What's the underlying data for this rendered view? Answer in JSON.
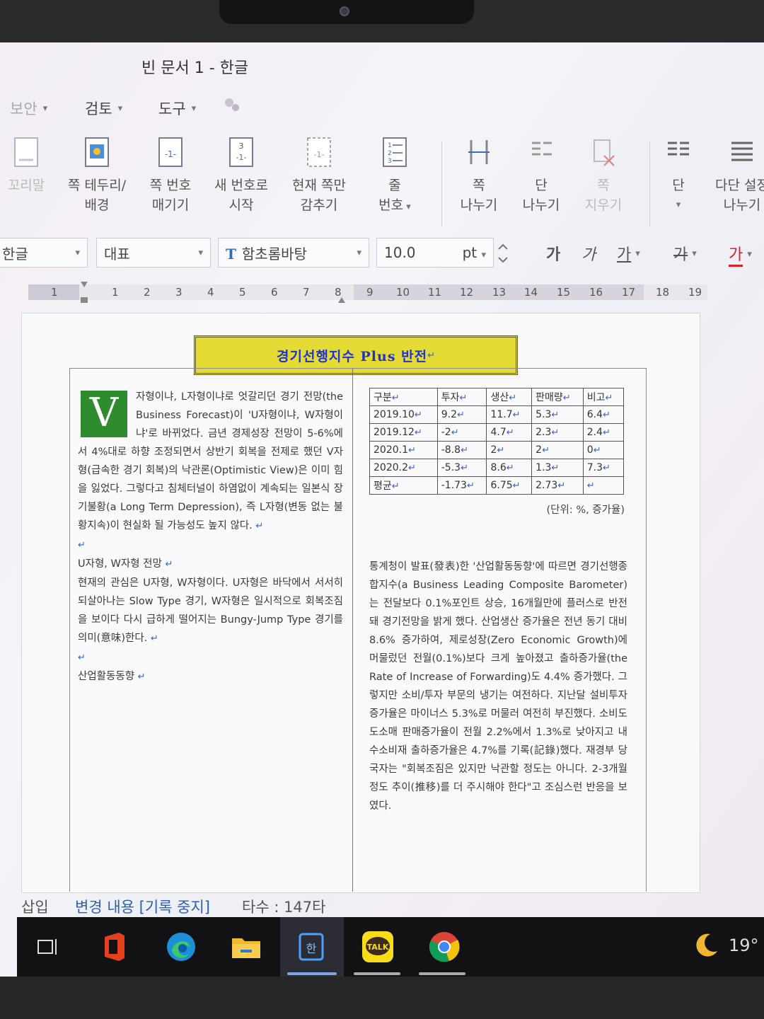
{
  "window": {
    "title": "빈 문서 1 - 한글"
  },
  "menu": [
    {
      "label": "보안"
    },
    {
      "label": "검토"
    },
    {
      "label": "도구"
    }
  ],
  "ribbon": [
    {
      "label1": "꼬리말",
      "label2": ""
    },
    {
      "label1": "쪽 테두리/",
      "label2": "배경"
    },
    {
      "label1": "쪽 번호",
      "label2": "매기기"
    },
    {
      "label1": "새 번호로",
      "label2": "시작"
    },
    {
      "label1": "현재 쪽만",
      "label2": "감추기"
    },
    {
      "label1": "줄",
      "label2": "번호"
    },
    {
      "label1": "쪽",
      "label2": "나누기"
    },
    {
      "label1": "단",
      "label2": "나누기"
    },
    {
      "label1": "쪽",
      "label2": "지우기"
    },
    {
      "label1": "단",
      "label2": ""
    },
    {
      "label1": "다단 설정",
      "label2": "나누기"
    }
  ],
  "format": {
    "language": "한글",
    "style": "대표",
    "font": "함초롬바탕",
    "font_glyph": "T",
    "size": "10.0",
    "unit": "pt",
    "bold": "가",
    "italic": "가",
    "underline": "가",
    "strike": "가",
    "color": "가",
    "color_accent": "#e02020"
  },
  "ruler": {
    "ticks": [
      "1",
      "1",
      "2",
      "3",
      "4",
      "5",
      "6",
      "7",
      "8",
      "9",
      "10",
      "11",
      "12",
      "13",
      "14",
      "15",
      "16",
      "17",
      "18",
      "19"
    ]
  },
  "document": {
    "title": "경기선행지수 Plus 반전",
    "dropcap": "V",
    "left_paragraphs": [
      "자형이냐, L자형이냐로 엇갈리던 경기 전망(the Business Forecast)이 'U자형이냐, W자형이냐'로 바뀌었다. 금년 경제성장 전망이 5-6%에서 4%대로 하향 조정되면서 상반기 회복을 전제로 했던 V자형(급속한 경기 회복)의 낙관론(Optimistic View)은 이미 힘을 잃었다. 그렇다고 침체터널이 하염없이 계속되는 일본식 장기불황(a Long Term Depression), 즉 L자형(변동 없는 불황지속)이 현실화 될 가능성도 높지 않다.",
      "",
      "U자형, W자형 전망",
      "현재의 관심은 U자형, W자형이다. U자형은 바닥에서 서서히 되살아나는 Slow Type 경기, W자형은 일시적으로 회복조짐을 보이다 다시 급하게 떨어지는 Bungy-Jump Type 경기를 의미(意味)한다.",
      "",
      "산업활동동향"
    ],
    "table": {
      "headers": [
        "구분",
        "투자",
        "생산",
        "판매량",
        "비고"
      ],
      "rows": [
        [
          "2019.10",
          "9.2",
          "11.7",
          "5.3",
          "6.4"
        ],
        [
          "2019.12",
          "-2",
          "4.7",
          "2.3",
          "2.4"
        ],
        [
          "2020.1",
          "-8.8",
          "2",
          "2",
          "0"
        ],
        [
          "2020.2",
          "-5.3",
          "8.6",
          "1.3",
          "7.3"
        ],
        [
          "평균",
          "-1.73",
          "6.75",
          "2.73",
          ""
        ]
      ],
      "note": "(단위: %, 증가율)"
    },
    "right_paragraph": "통계청이 발표(發表)한 '산업활동동향'에 따르면 경기선행종합지수(a Business Leading Composite Barometer)는 전달보다 0.1%포인트 상승, 16개월만에 플러스로 반전돼 경기전망을 밝게 했다. 산업생산 증가율은 전년 동기 대비 8.6% 증가하여, 제로성장(Zero Economic Growth)에 머물렀던 전월(0.1%)보다 크게 높아졌고 출하증가율(the Rate of Increase of Forwarding)도 4.4% 증가했다. 그렇지만 소비/투자 부문의 냉기는 여전하다. 지난달 설비투자 증가율은 마이너스 5.3%로 머물러 여전히 부진했다. 소비도 도소매 판매증가율이 전월 2.2%에서 1.3%로 낮아지고 내수소비재 출하증가율은 4.7%를 기록(記錄)했다. 재경부 당국자는 \"회복조짐은 있지만 낙관할 정도는 아니다. 2-3개월 정도 추이(推移)를 더 주시해야 한다\"고 조심스런 반응을 보였다.",
    "return_mark": "↵"
  },
  "status": {
    "mode": "삽입",
    "track": "변경 내용 [기록 중지]",
    "keystrokes": "타수 : 147타"
  },
  "taskbar": {
    "apps": [
      "task-view",
      "office",
      "edge",
      "file-explorer",
      "hwp",
      "kakaotalk",
      "chrome"
    ],
    "kakao_label": "TALK",
    "hwp_label": "한",
    "temperature": "19°"
  },
  "colors": {
    "title_box": "#e4dc34",
    "title_text": "#2233cc",
    "dropcap": "#2e8b2e",
    "return_mark": "#3a62c8"
  }
}
